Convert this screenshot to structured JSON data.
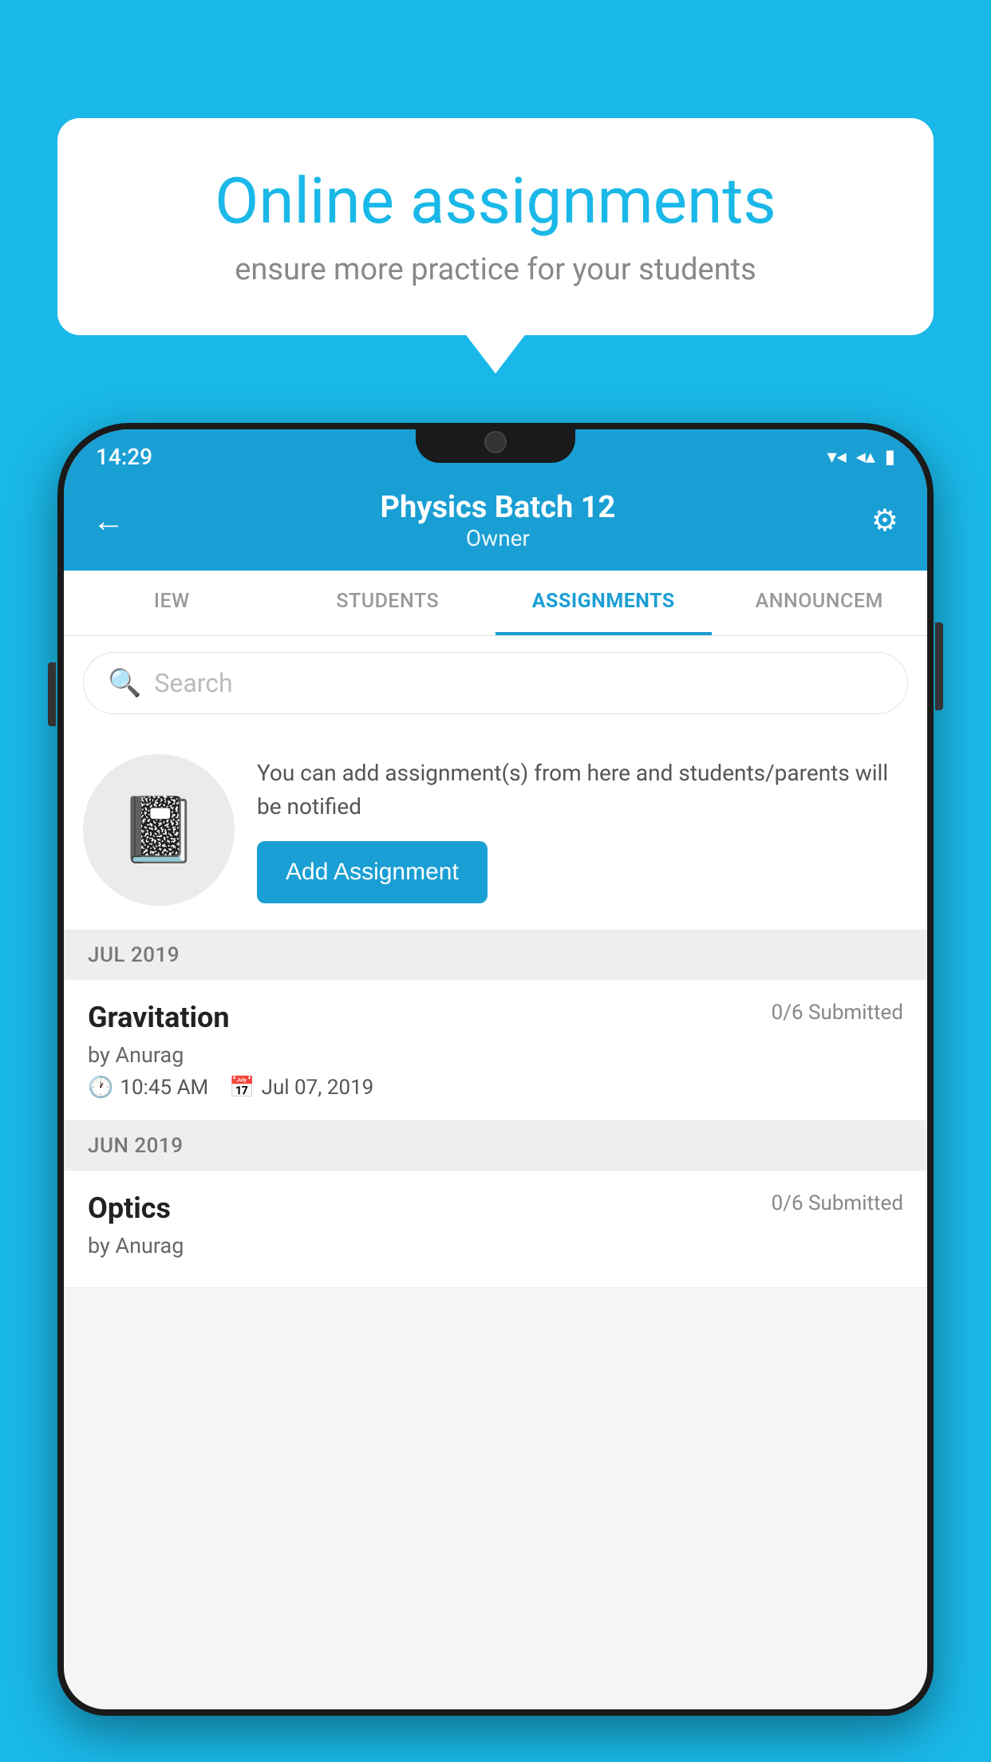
{
  "background_color": "#1ab8e8",
  "speech_bubble": {
    "title": "Online assignments",
    "subtitle": "ensure more practice for your students"
  },
  "status_bar": {
    "time": "14:29",
    "icons": [
      "wifi",
      "signal",
      "battery"
    ]
  },
  "app_header": {
    "title": "Physics Batch 12",
    "subtitle": "Owner",
    "back_label": "←",
    "settings_label": "⚙"
  },
  "tabs": [
    {
      "label": "IEW",
      "active": false
    },
    {
      "label": "STUDENTS",
      "active": false
    },
    {
      "label": "ASSIGNMENTS",
      "active": true
    },
    {
      "label": "ANNOUNCEM",
      "active": false
    }
  ],
  "search": {
    "placeholder": "Search"
  },
  "info_card": {
    "text": "You can add assignment(s) from here and students/parents will be notified",
    "button_label": "Add Assignment"
  },
  "sections": [
    {
      "month_label": "JUL 2019",
      "assignments": [
        {
          "name": "Gravitation",
          "submitted": "0/6 Submitted",
          "by": "by Anurag",
          "time": "10:45 AM",
          "date": "Jul 07, 2019"
        }
      ]
    },
    {
      "month_label": "JUN 2019",
      "assignments": [
        {
          "name": "Optics",
          "submitted": "0/6 Submitted",
          "by": "by Anurag",
          "time": "",
          "date": ""
        }
      ]
    }
  ]
}
